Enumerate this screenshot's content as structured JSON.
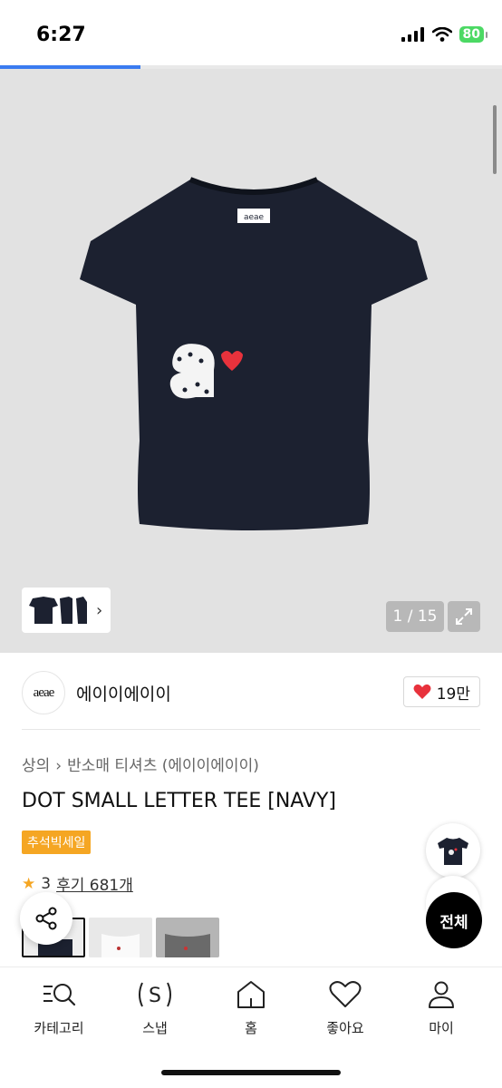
{
  "status_bar": {
    "time": "6:27",
    "battery": "80"
  },
  "gallery": {
    "counter": "1 / 15",
    "progress": 0.28
  },
  "brand": {
    "logo_text": "aeae",
    "name": "에이이에이이",
    "likes": "19만"
  },
  "breadcrumb": {
    "category": "상의",
    "subcategory": "반소매 티셔츠 (에이이에이이)"
  },
  "product": {
    "title": "DOT SMALL LETTER TEE [NAVY]",
    "badge": "추석빅세일",
    "rating_partial": "3",
    "reviews": "후기 681개"
  },
  "floating": {
    "all_label": "전체"
  },
  "nav": {
    "items": [
      {
        "label": "카테고리",
        "icon": "category-search-icon"
      },
      {
        "label": "스냅",
        "icon": "snap-icon"
      },
      {
        "label": "홈",
        "icon": "home-icon"
      },
      {
        "label": "좋아요",
        "icon": "heart-icon"
      },
      {
        "label": "마이",
        "icon": "user-icon"
      }
    ]
  },
  "colors": {
    "accent": "#3a7bf0",
    "sale": "#f5a623",
    "heart": "#e8323c",
    "shirt": "#1c2130"
  }
}
